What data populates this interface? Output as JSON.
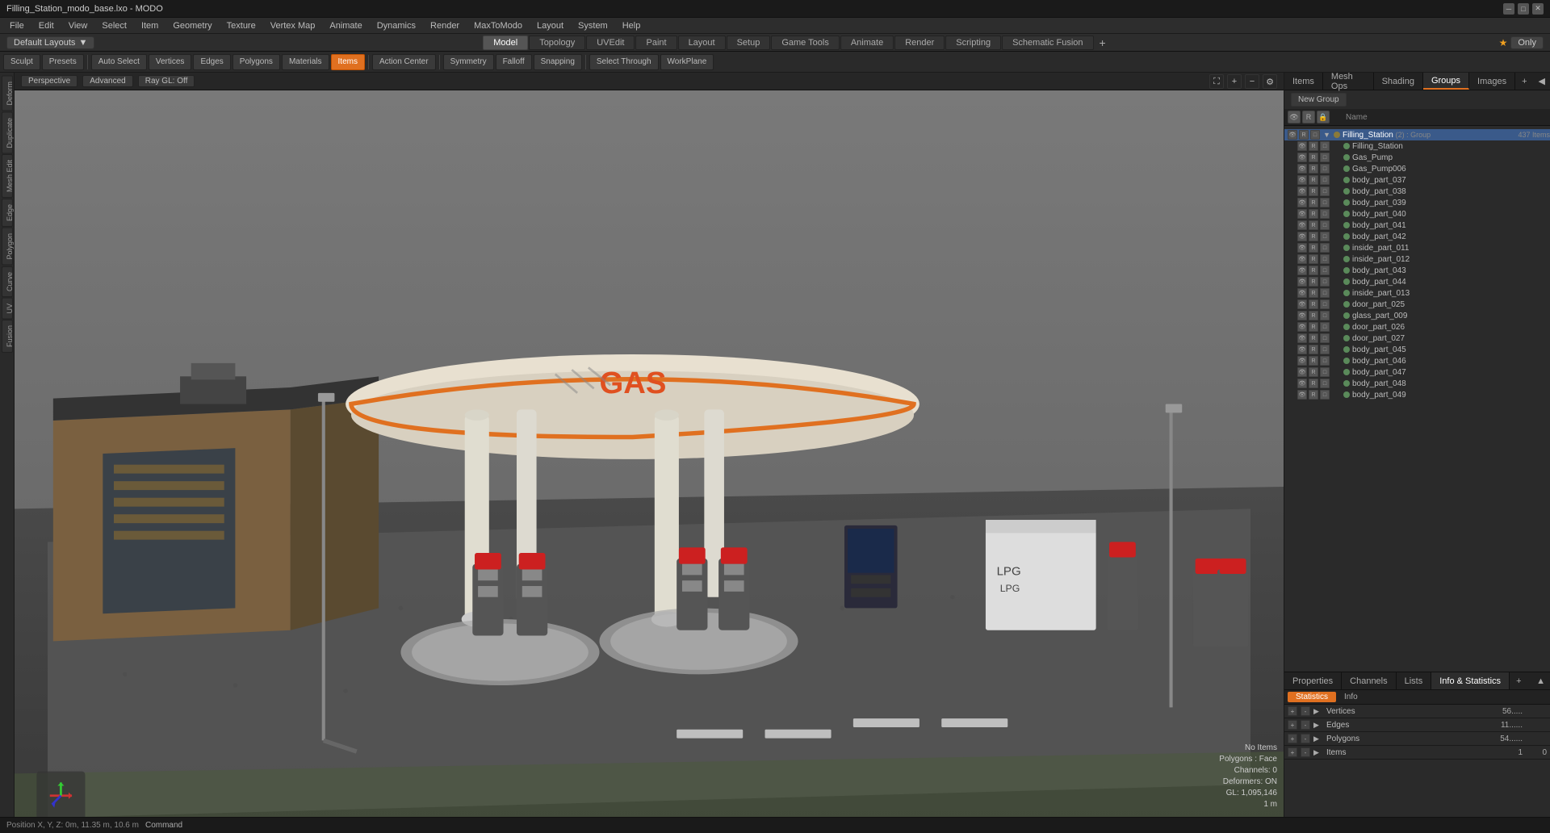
{
  "window": {
    "title": "Filling_Station_modo_base.lxo - MODO"
  },
  "titlebar": {
    "title": "Filling_Station_modo_base.lxo - MODO",
    "minimize": "─",
    "maximize": "□",
    "close": "✕"
  },
  "menubar": {
    "items": [
      "File",
      "Edit",
      "View",
      "Select",
      "Item",
      "Geometry",
      "Texture",
      "Vertex Map",
      "Animate",
      "Dynamics",
      "Render",
      "MaxToModo",
      "Layout",
      "System",
      "Help"
    ]
  },
  "tabbar": {
    "layouts_label": "Default Layouts",
    "tabs": [
      "Model",
      "Topology",
      "UVEdit",
      "Paint",
      "Layout",
      "Setup",
      "Game Tools",
      "Animate",
      "Render",
      "Scripting",
      "Schematic Fusion"
    ],
    "active_tab": "Model",
    "star": "★",
    "only": "Only"
  },
  "toolbar": {
    "sculpt": "Sculpt",
    "presets": "Presets",
    "auto_select": "Auto Select",
    "vertices": "Vertices",
    "edges": "Edges",
    "polygons": "Polygons",
    "materials": "Materials",
    "items": "Items",
    "action_center": "Action Center",
    "symmetry": "Symmetry",
    "falloff": "Falloff",
    "snapping": "Snapping",
    "select_through": "Select Through",
    "workplane": "WorkPlane"
  },
  "viewport": {
    "perspective": "Perspective",
    "advanced": "Advanced",
    "ray_gl": "Ray GL: Off",
    "no_items": "No Items",
    "polygons_face": "Polygons : Face",
    "channels": "Channels: 0",
    "deformers": "Deformers: ON",
    "gl_info": "GL: 1,095,146",
    "scale": "1 m",
    "position": "Position X, Y, Z:  0m, 11.35 m, 10.6 m"
  },
  "right_panel": {
    "tabs": [
      "Items",
      "Mesh Ops",
      "Shading",
      "Groups",
      "Images"
    ],
    "active_tab": "Groups",
    "new_group_btn": "New Group",
    "col_name": "Name",
    "scene_items": [
      {
        "name": "Filling_Station",
        "type": "group",
        "suffix": "(2) : Group",
        "indent": 0,
        "expanded": true,
        "count": "437 Items"
      },
      {
        "name": "Filling_Station",
        "type": "mesh",
        "indent": 1
      },
      {
        "name": "Gas_Pump",
        "type": "mesh",
        "indent": 1
      },
      {
        "name": "Gas_Pump006",
        "type": "mesh",
        "indent": 1
      },
      {
        "name": "body_part_037",
        "type": "mesh",
        "indent": 1
      },
      {
        "name": "body_part_038",
        "type": "mesh",
        "indent": 1
      },
      {
        "name": "body_part_039",
        "type": "mesh",
        "indent": 1
      },
      {
        "name": "body_part_040",
        "type": "mesh",
        "indent": 1
      },
      {
        "name": "body_part_041",
        "type": "mesh",
        "indent": 1
      },
      {
        "name": "body_part_042",
        "type": "mesh",
        "indent": 1
      },
      {
        "name": "inside_part_011",
        "type": "mesh",
        "indent": 1
      },
      {
        "name": "inside_part_012",
        "type": "mesh",
        "indent": 1
      },
      {
        "name": "body_part_043",
        "type": "mesh",
        "indent": 1
      },
      {
        "name": "body_part_044",
        "type": "mesh",
        "indent": 1
      },
      {
        "name": "inside_part_013",
        "type": "mesh",
        "indent": 1
      },
      {
        "name": "door_part_025",
        "type": "mesh",
        "indent": 1
      },
      {
        "name": "glass_part_009",
        "type": "mesh",
        "indent": 1
      },
      {
        "name": "door_part_026",
        "type": "mesh",
        "indent": 1
      },
      {
        "name": "door_part_027",
        "type": "mesh",
        "indent": 1
      },
      {
        "name": "body_part_045",
        "type": "mesh",
        "indent": 1
      },
      {
        "name": "body_part_046",
        "type": "mesh",
        "indent": 1
      },
      {
        "name": "body_part_047",
        "type": "mesh",
        "indent": 1
      },
      {
        "name": "body_part_048",
        "type": "mesh",
        "indent": 1
      },
      {
        "name": "body_part_049",
        "type": "mesh",
        "indent": 1
      }
    ]
  },
  "bottom_panel": {
    "tabs": [
      "Properties",
      "Channels",
      "Lists",
      "Info & Statistics"
    ],
    "active_tab": "Info & Statistics",
    "stats_tabs": [
      "Statistics",
      "Info"
    ],
    "active_stats_tab": "Statistics",
    "stats": [
      {
        "name": "Vertices",
        "num": "56.....",
        "sel": ""
      },
      {
        "name": "Edges",
        "num": "11......",
        "sel": ""
      },
      {
        "name": "Polygons",
        "num": "54......",
        "sel": ""
      },
      {
        "name": "Items",
        "num": "1",
        "sel": "0"
      }
    ]
  },
  "statusbar": {
    "position": "Position X, Y, Z:  0m, 11.35 m, 10.6 m",
    "command_label": "Command"
  },
  "colors": {
    "accent": "#e07020",
    "active_tab_bg": "#555",
    "bg_dark": "#1a1a1a",
    "bg_mid": "#2a2a2a",
    "bg_light": "#333",
    "group_color": "#8a7a3a",
    "mesh_color": "#5a8a5a",
    "blue_sel": "#3a5a8a"
  }
}
